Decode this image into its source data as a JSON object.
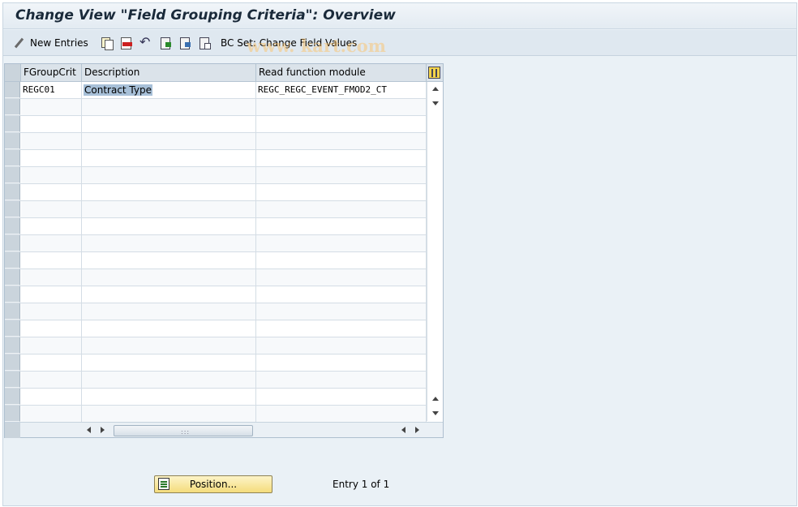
{
  "window": {
    "title": "Change View \"Field Grouping Criteria\": Overview"
  },
  "toolbar": {
    "items": [
      {
        "name": "new-entries",
        "icon": "pencil-glasses-icon",
        "label": "New Entries"
      },
      {
        "name": "copy-as",
        "icon": "copy-icon",
        "label": ""
      },
      {
        "name": "delete",
        "icon": "delete-icon",
        "label": ""
      },
      {
        "name": "undo-change",
        "icon": "undo-icon",
        "label": ""
      },
      {
        "name": "select-all",
        "icon": "select-all-icon",
        "label": ""
      },
      {
        "name": "select-block",
        "icon": "select-block-icon",
        "label": ""
      },
      {
        "name": "deselect-all",
        "icon": "deselect-all-icon",
        "label": ""
      },
      {
        "name": "bc-set",
        "icon": "",
        "label": "BC Set: Change Field Values"
      }
    ]
  },
  "watermark": "www.tcodesearch.com / sapkart.com",
  "watermark_visible": "www.        kart.com",
  "table": {
    "columns": [
      "FGroupCrit",
      "Description",
      "Read function module"
    ],
    "rows": [
      {
        "fgroupcrit": "REGC01",
        "description": "Contract Type",
        "read_function_module": "REGC_REGC_EVENT_FMOD2_CT"
      }
    ],
    "empty_rows": 19
  },
  "footer": {
    "position_button": "Position...",
    "entry_info": "Entry 1 of 1"
  },
  "colors": {
    "background": "#eaf1f6",
    "button_accent": "#f4dc7c",
    "selection": "#a7c0d8"
  }
}
